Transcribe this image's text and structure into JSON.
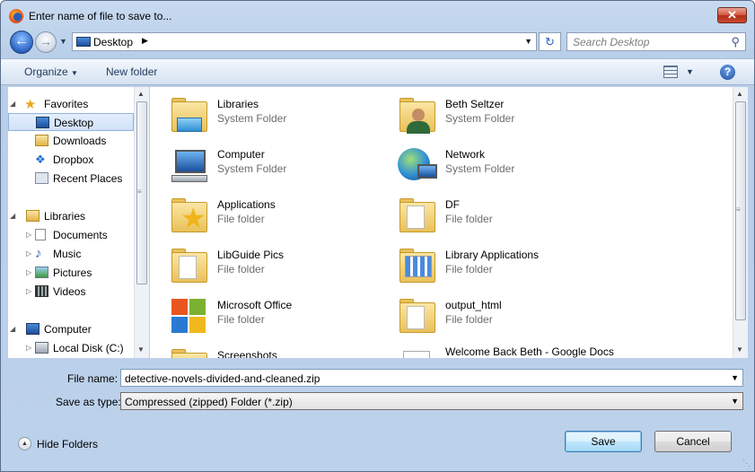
{
  "window": {
    "title": "Enter name of file to save to...",
    "close_label": "✕"
  },
  "address": {
    "location": "Desktop",
    "search_placeholder": "Search Desktop"
  },
  "toolbar": {
    "organize_label": "Organize",
    "new_folder_label": "New folder",
    "help_label": "?"
  },
  "sidebar": {
    "favorites": "Favorites",
    "items": [
      {
        "label": "Desktop",
        "icon": "desktop-icon"
      },
      {
        "label": "Downloads",
        "icon": "downloads-icon"
      },
      {
        "label": "Dropbox",
        "icon": "dropbox-icon"
      },
      {
        "label": "Recent Places",
        "icon": "recent-places-icon"
      }
    ],
    "libraries": "Libraries",
    "library_items": [
      {
        "label": "Documents",
        "icon": "documents-icon"
      },
      {
        "label": "Music",
        "icon": "music-icon"
      },
      {
        "label": "Pictures",
        "icon": "pictures-icon"
      },
      {
        "label": "Videos",
        "icon": "videos-icon"
      }
    ],
    "computer": "Computer",
    "computer_items": [
      {
        "label": "Local Disk (C:)",
        "icon": "drive-icon"
      }
    ]
  },
  "files": [
    {
      "name": "Libraries",
      "type": "System Folder",
      "icon": "libraries-folder-icon"
    },
    {
      "name": "Beth Seltzer",
      "type": "System Folder",
      "icon": "user-folder-icon"
    },
    {
      "name": "Computer",
      "type": "System Folder",
      "icon": "computer-icon"
    },
    {
      "name": "Network",
      "type": "System Folder",
      "icon": "network-icon"
    },
    {
      "name": "Applications",
      "type": "File folder",
      "icon": "star-folder-icon"
    },
    {
      "name": "DF",
      "type": "File folder",
      "icon": "folder-icon"
    },
    {
      "name": "LibGuide Pics",
      "type": "File folder",
      "icon": "folder-icon"
    },
    {
      "name": "Library Applications",
      "type": "File folder",
      "icon": "folder-icon"
    },
    {
      "name": "Microsoft Office",
      "type": "File folder",
      "icon": "office-icon"
    },
    {
      "name": "output_html",
      "type": "File folder",
      "icon": "folder-icon"
    },
    {
      "name": "Screenshots",
      "type": "",
      "icon": "folder-icon"
    },
    {
      "name": "Welcome Back Beth - Google Docs",
      "type": "",
      "icon": "document-icon"
    }
  ],
  "form": {
    "file_name_label": "File name:",
    "file_name_value": "detective-novels-divided-and-cleaned.zip",
    "save_type_label": "Save as type:",
    "save_type_value": "Compressed (zipped) Folder (*.zip)"
  },
  "footer": {
    "hide_folders": "Hide Folders",
    "save": "Save",
    "cancel": "Cancel"
  }
}
